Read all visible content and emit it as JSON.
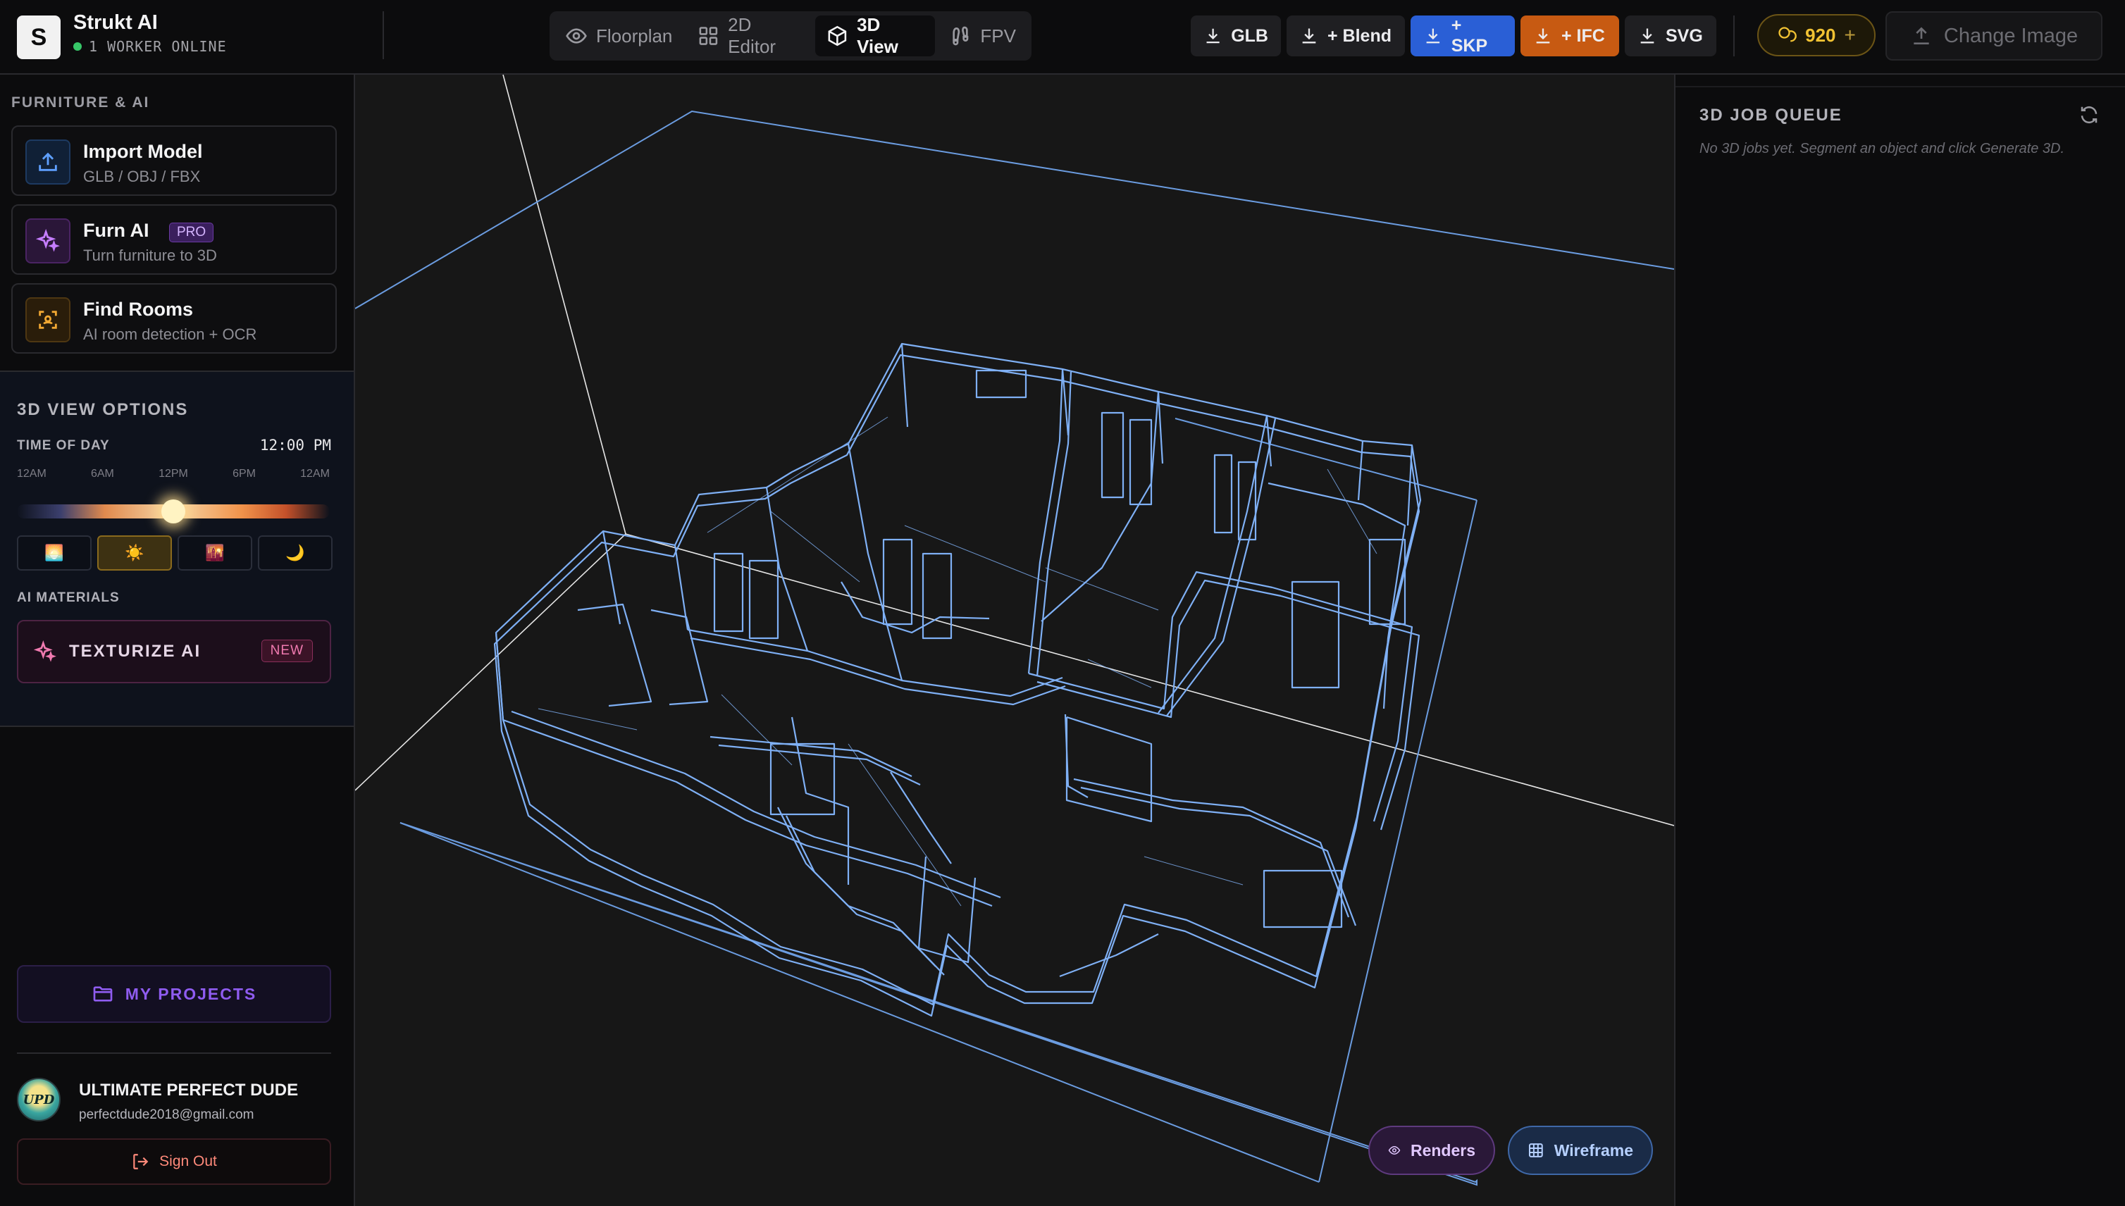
{
  "app": {
    "logo_letter": "S",
    "title": "Strukt AI",
    "worker_status": "1 WORKER ONLINE"
  },
  "view_tabs": [
    {
      "label": "Floorplan",
      "icon": "eye-icon",
      "active": false
    },
    {
      "label": "2D Editor",
      "icon": "grid-icon",
      "active": false
    },
    {
      "label": "3D View",
      "icon": "cube-icon",
      "active": true
    },
    {
      "label": "FPV",
      "icon": "footsteps-icon",
      "active": false
    }
  ],
  "exports": {
    "glb": "GLB",
    "blend": "+ Blend",
    "skp": "+ SKP",
    "ifc": "+ IFC",
    "svg": "SVG"
  },
  "credits": {
    "value": "920",
    "plus": "+"
  },
  "change_image": "Change Image",
  "sidebar": {
    "furniture_heading": "FURNITURE & AI",
    "import": {
      "title": "Import Model",
      "subtitle": "GLB / OBJ / FBX"
    },
    "furn_ai": {
      "title": "Furn AI",
      "badge": "PRO",
      "subtitle": "Turn furniture to 3D"
    },
    "find_rooms": {
      "title": "Find Rooms",
      "subtitle": "AI room detection + OCR"
    },
    "options": {
      "heading": "3D VIEW OPTIONS",
      "time_label": "TIME OF DAY",
      "time_value": "12:00 PM",
      "ticks": [
        "12AM",
        "6AM",
        "12PM",
        "6PM",
        "12AM"
      ],
      "time_fraction": 0.5,
      "presets": [
        "🌅",
        "☀️",
        "🌇",
        "🌙"
      ],
      "materials_heading": "AI MATERIALS",
      "texturize_label": "TEXTURIZE AI",
      "texturize_badge": "NEW"
    },
    "projects_label": "MY PROJECTS",
    "user": {
      "initials": "UPD",
      "name": "ULTIMATE PERFECT DUDE",
      "email": "perfectdude2018@gmail.com"
    },
    "signout_label": "Sign Out"
  },
  "viewport": {
    "renders_label": "Renders",
    "wireframe_label": "Wireframe",
    "wire_color": "#7fb0f5"
  },
  "queue": {
    "heading": "3D JOB QUEUE",
    "empty": "No 3D jobs yet. Segment an object and click Generate 3D."
  },
  "colors": {
    "accent_skp": "#2a5fd6",
    "accent_ifc": "#c75a12",
    "credits": "#f1c233",
    "online": "#37c768"
  }
}
